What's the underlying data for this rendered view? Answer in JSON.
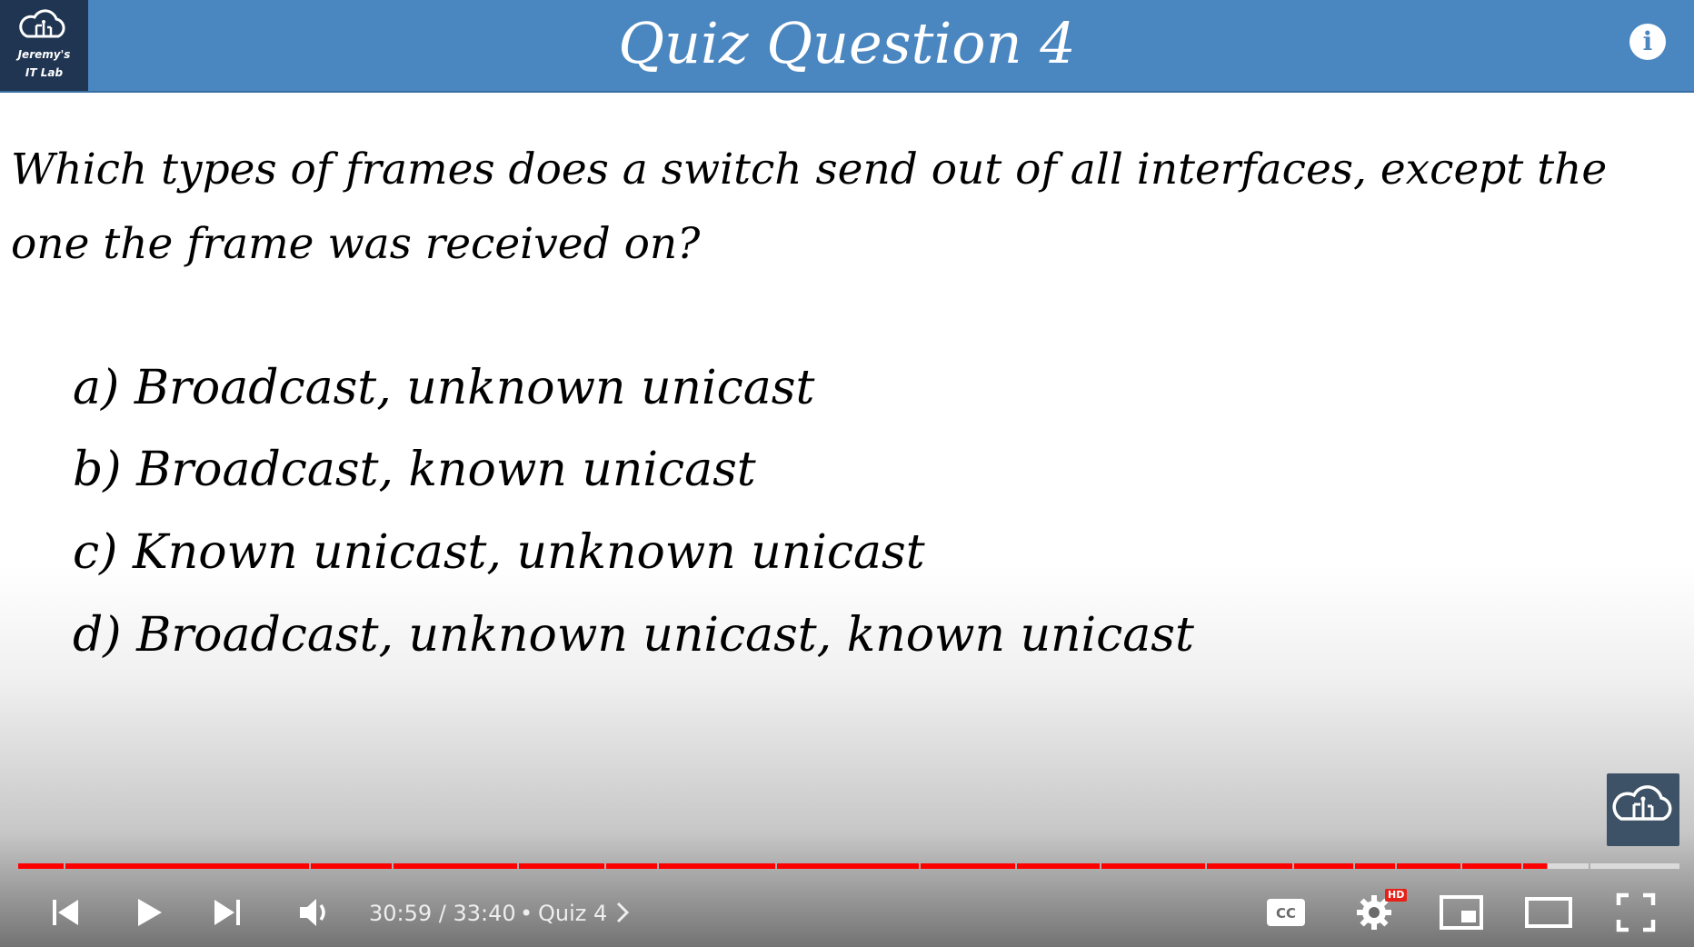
{
  "header": {
    "title": "Quiz Question 4",
    "logo_name": "Jeremy's",
    "logo_sub": "IT Lab",
    "bg_color": "#4a86c0",
    "logo_bg_color": "#1f3552"
  },
  "question": {
    "text": "Which types of frames does a switch send out of all interfaces, except the one the frame was received on?"
  },
  "options": [
    {
      "label": "a) Broadcast, unknown unicast"
    },
    {
      "label": "b) Broadcast, known unicast"
    },
    {
      "label": "c) Known unicast, unknown unicast"
    },
    {
      "label": "d) Broadcast, unknown unicast, known unicast"
    }
  ],
  "player": {
    "time_current": "30:59",
    "time_total": "33:40",
    "time_display": "30:59 / 33:40",
    "chapter_separator": "•",
    "chapter": "Quiz 4",
    "played_fraction": 0.9205,
    "quality_badge": "HD",
    "accent_color": "#ff0000",
    "icons": [
      "previous-icon",
      "play-icon",
      "next-icon",
      "volume-icon",
      "chevron-right-icon",
      "captions-icon",
      "settings-icon",
      "miniplayer-icon",
      "theater-icon",
      "fullscreen-icon",
      "info-icon",
      "channel-watermark-icon"
    ]
  }
}
